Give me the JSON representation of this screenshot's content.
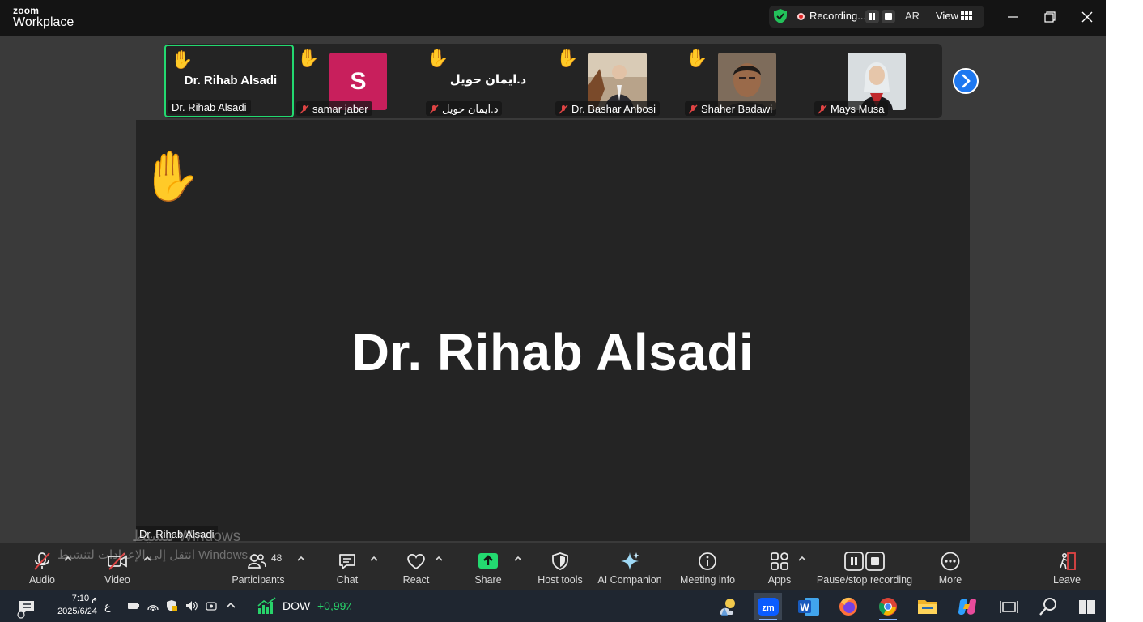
{
  "app": {
    "logo_line1": "zoom",
    "logo_line2": "Workplace"
  },
  "titlebar": {
    "recording_label": "Recording...",
    "language": "AR",
    "view_label": "View"
  },
  "thumbnails": [
    {
      "name": "Dr. Rihab Alsadi",
      "center_name": "Dr. Rihab Alsadi",
      "type": "name",
      "hand_raised": true,
      "muted": false,
      "active": true
    },
    {
      "name": "samar jaber",
      "avatar_letter": "S",
      "type": "avatar",
      "avatar_color": "#c81f5c",
      "hand_raised": true,
      "muted": true
    },
    {
      "name": "د.ايمان حويل",
      "center_name": "د.ايمان حويل",
      "type": "name",
      "hand_raised": true,
      "muted": true
    },
    {
      "name": "Dr. Bashar Anbosi",
      "type": "photo",
      "hand_raised": true,
      "muted": true
    },
    {
      "name": "Shaher Badawi",
      "type": "photo",
      "hand_raised": true,
      "muted": true
    },
    {
      "name": "Mays Musa",
      "type": "photo",
      "hand_raised": false,
      "muted": true
    }
  ],
  "stage": {
    "speaker_name": "Dr. Rihab Alsadi",
    "name_label": "Dr. Rihab Alsadi",
    "hand_raised": true
  },
  "watermark": {
    "line1": "تنشيط Windows",
    "line2": "انتقل إلى الإعدادات لتنشيط Windows."
  },
  "toolbar": {
    "audio": "Audio",
    "video": "Video",
    "participants": "Participants",
    "participants_count": "48",
    "chat": "Chat",
    "react": "React",
    "share": "Share",
    "host_tools": "Host tools",
    "ai_companion": "AI Companion",
    "meeting_info": "Meeting info",
    "apps": "Apps",
    "pause_stop_recording": "Pause/stop recording",
    "more": "More",
    "leave": "Leave"
  },
  "taskbar": {
    "time": "7:10 م",
    "date": "2025/6/24",
    "keyboard_lang": "ع",
    "stock_name": "DOW",
    "stock_change": "+0,99٪",
    "stock_color": "#28d36a",
    "apps": [
      "weather-widget",
      "zoom",
      "word",
      "firefox",
      "chrome",
      "file-explorer",
      "copilot",
      "task-view",
      "search",
      "start"
    ]
  },
  "colors": {
    "active_border": "#23d970",
    "share_green": "#23d970",
    "record_red": "#e02828",
    "next_button": "#1e78f0"
  }
}
